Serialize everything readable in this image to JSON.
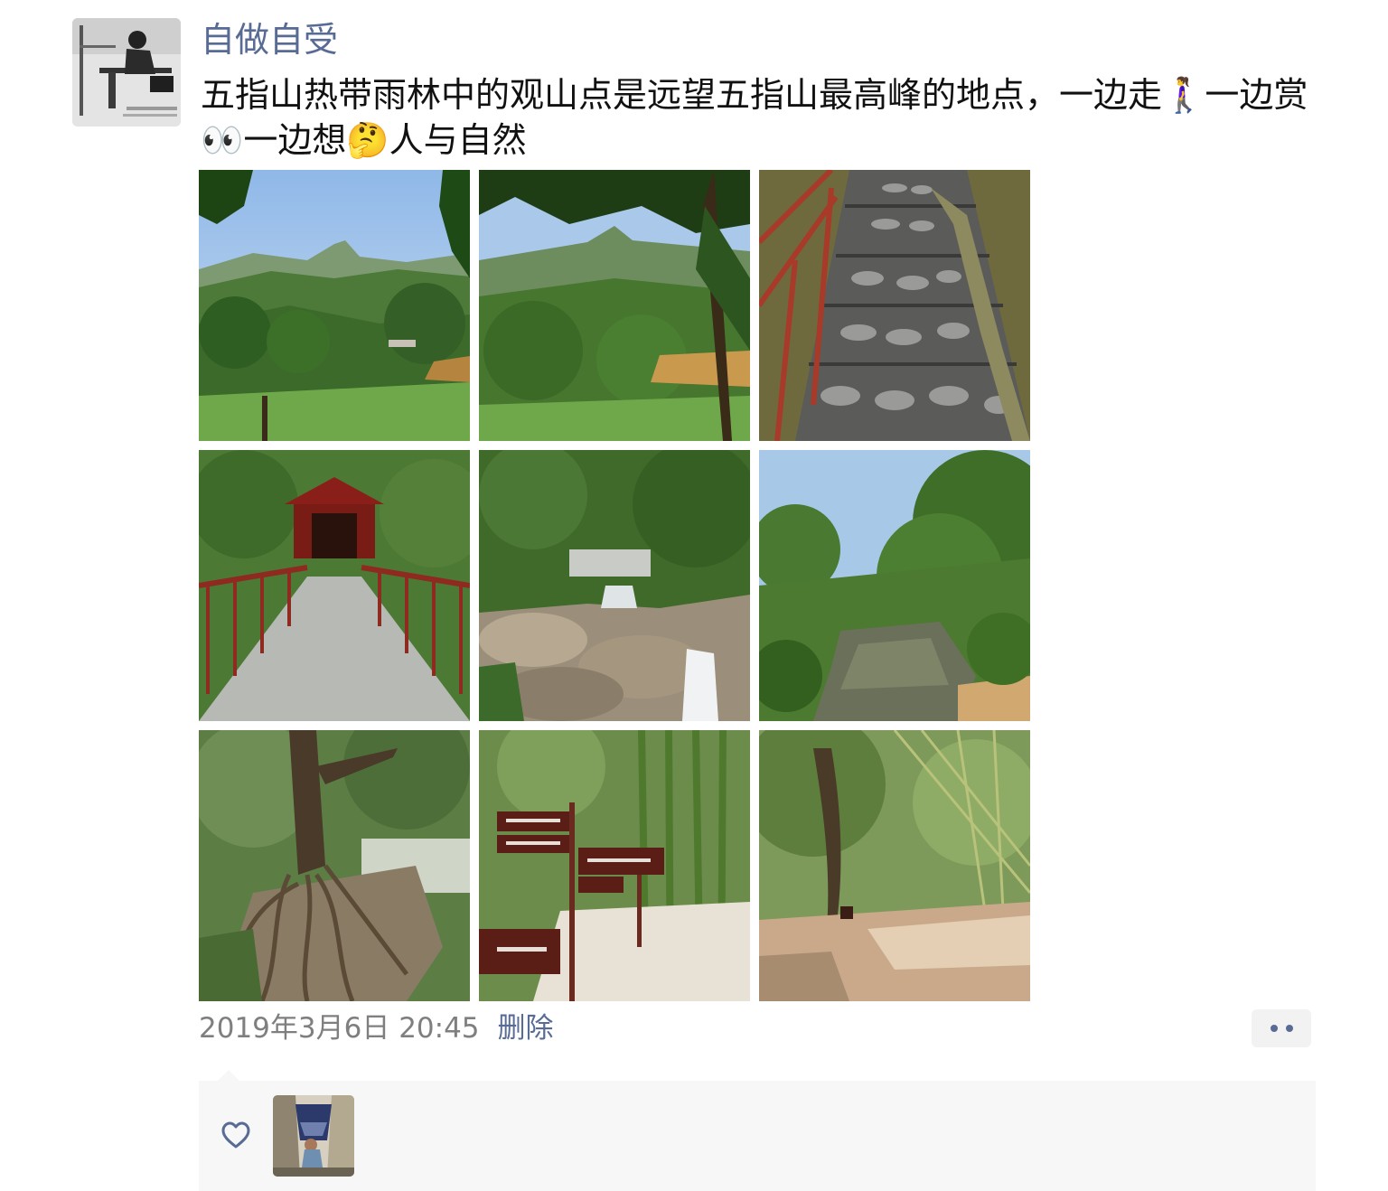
{
  "post": {
    "author": "自做自受",
    "text": "五指山热带雨林中的观山点是远望五指山最高峰的地点，一边走🚶‍♀️一边赏👀一边想🤔人与自然",
    "photos": [
      {
        "icon": "mountain-view-photo"
      },
      {
        "icon": "tree-valley-photo"
      },
      {
        "icon": "stone-steps-photo"
      },
      {
        "icon": "red-bridge-photo"
      },
      {
        "icon": "waterfall-rocks-photo"
      },
      {
        "icon": "river-forest-photo"
      },
      {
        "icon": "banyan-roots-photo"
      },
      {
        "icon": "trail-signs-photo"
      },
      {
        "icon": "bamboo-grove-photo"
      }
    ],
    "timestamp": "2019年3月6日 20:45",
    "delete_label": "删除",
    "more_icon": "more-dots-icon"
  },
  "likes": {
    "heart_icon": "heart-icon",
    "likers": [
      {
        "icon": "liker-avatar"
      }
    ]
  },
  "colors": {
    "link": "#576b95",
    "text": "#111111",
    "meta": "#7f7f7f",
    "likes_bg": "#f7f7f7"
  }
}
